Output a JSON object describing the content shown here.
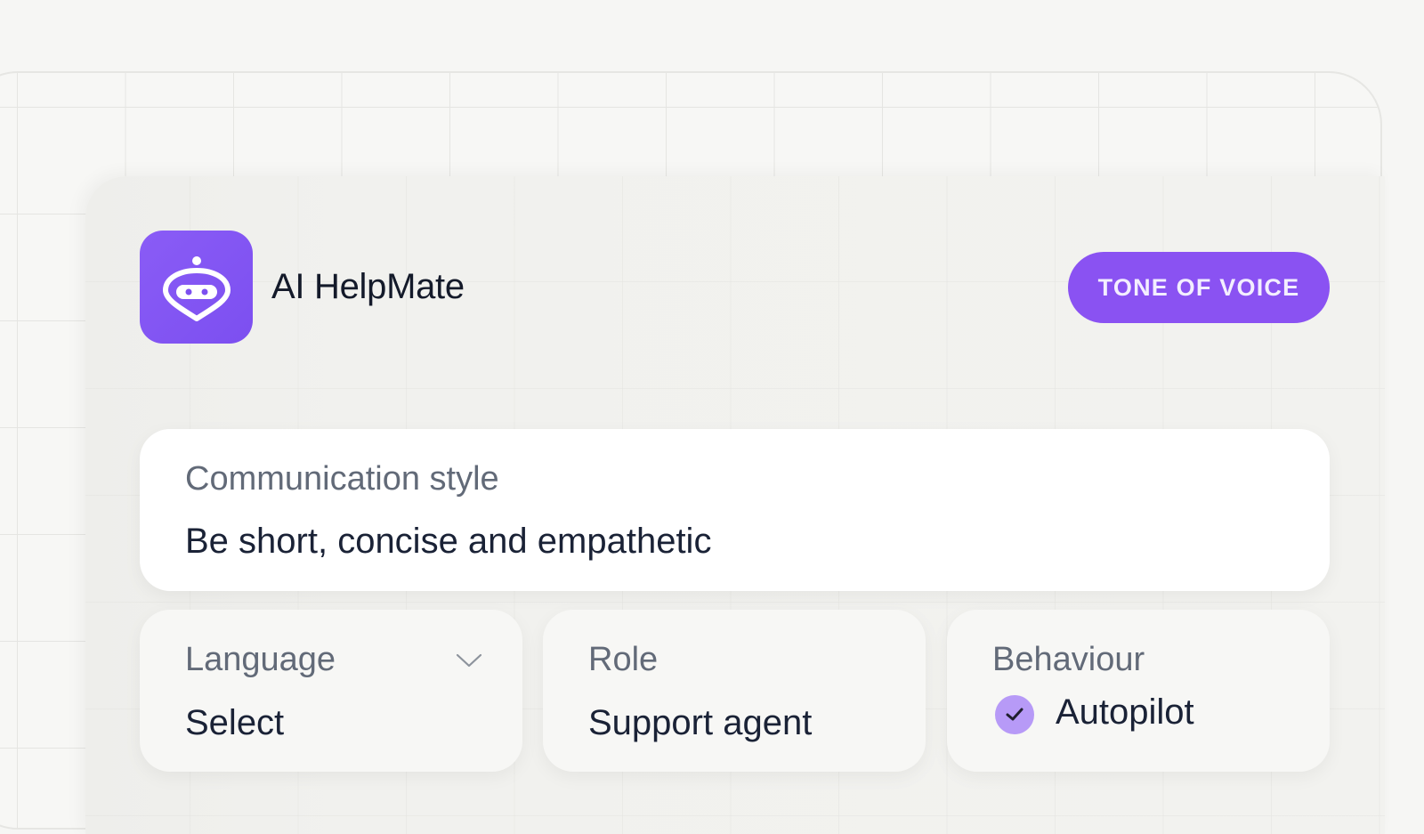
{
  "app": {
    "name": "AI HelpMate",
    "icon": "robot-icon",
    "accent_color": "#8a52f2"
  },
  "header": {
    "tone_button_label": "TONE OF VOICE"
  },
  "communication": {
    "label": "Communication style",
    "value": "Be short, concise and empathetic"
  },
  "language": {
    "label": "Language",
    "value": "Select",
    "icon": "chevron-down-icon"
  },
  "role": {
    "label": "Role",
    "value": "Support agent"
  },
  "behaviour": {
    "label": "Behaviour",
    "value": "Autopilot",
    "checked": true,
    "icon": "check-icon"
  }
}
